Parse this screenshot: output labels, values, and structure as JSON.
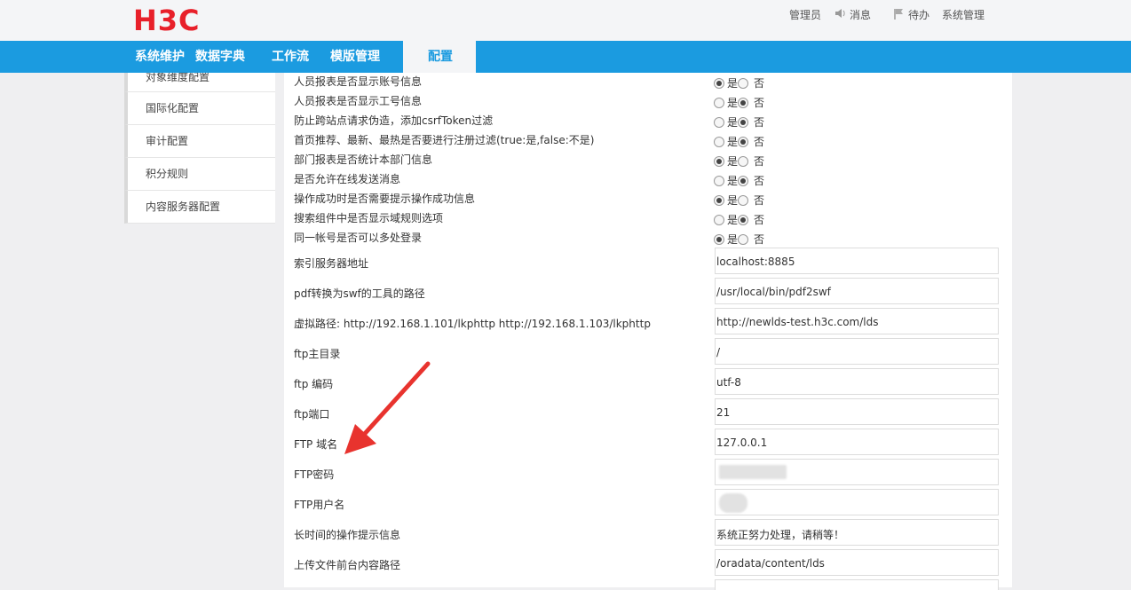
{
  "header": {
    "logo": "H3C",
    "user_links": [
      {
        "label": "管理员",
        "icon": ""
      },
      {
        "label": "消息",
        "icon": "speaker-icon"
      },
      {
        "label": "待办",
        "icon": "flag-icon"
      },
      {
        "label": "系统管理",
        "icon": ""
      }
    ]
  },
  "nav": {
    "items": [
      "系统维护",
      "数据字典",
      "工作流",
      "模版管理",
      "配置"
    ],
    "active": "配置"
  },
  "sidebar": {
    "items": [
      "对象维度配置",
      "国际化配置",
      "审计配置",
      "积分规则",
      "内容服务器配置"
    ]
  },
  "radio_text": {
    "yes": "是",
    "no": "否"
  },
  "bool_settings": [
    {
      "label": "人员报表是否显示账号信息",
      "value": "是"
    },
    {
      "label": "人员报表是否显示工号信息",
      "value": "否"
    },
    {
      "label": "防止跨站点请求伪造，添加csrfToken过滤",
      "value": "否"
    },
    {
      "label": "首页推荐、最新、最热是否要进行注册过滤(true:是,false:不是)",
      "value": "否"
    },
    {
      "label": "部门报表是否统计本部门信息",
      "value": "是"
    },
    {
      "label": "是否允许在线发送消息",
      "value": "否"
    },
    {
      "label": "操作成功时是否需要提示操作成功信息",
      "value": "是"
    },
    {
      "label": "搜索组件中是否显示域规则选项",
      "value": "否"
    },
    {
      "label": "同一帐号是否可以多处登录",
      "value": "是"
    }
  ],
  "text_settings": [
    {
      "label": "索引服务器地址",
      "value": "localhost:8885"
    },
    {
      "label": "pdf转换为swf的工具的路径",
      "value": "/usr/local/bin/pdf2swf"
    },
    {
      "label": "虚拟路径: http://192.168.1.101/lkphttp http://192.168.1.103/lkphttp",
      "value": "http://newlds-test.h3c.com/lds"
    },
    {
      "label": "ftp主目录",
      "value": "/"
    },
    {
      "label": "ftp 编码",
      "value": "utf-8"
    },
    {
      "label": "ftp端口",
      "value": "21"
    },
    {
      "label": "FTP 域名",
      "value": "127.0.0.1"
    },
    {
      "label": "FTP密码",
      "value": ""
    },
    {
      "label": "FTP用户名",
      "value": ""
    },
    {
      "label": "长时间的操作提示信息",
      "value": "系统正努力处理，请稍等！"
    },
    {
      "label": "上传文件前台内容路径",
      "value": "/oradata/content/lds"
    }
  ]
}
